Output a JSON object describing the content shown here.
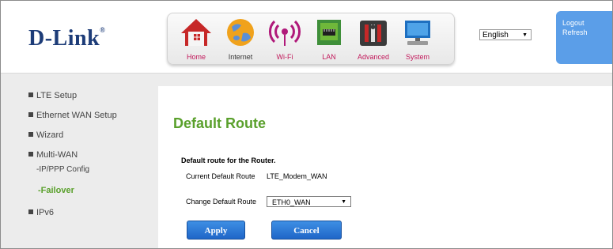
{
  "brand": {
    "logo": "D-Link"
  },
  "nav": [
    {
      "label": "Home",
      "icon": "home-icon",
      "active": false
    },
    {
      "label": "Internet",
      "icon": "globe-icon",
      "active": true
    },
    {
      "label": "Wi-Fi",
      "icon": "wifi-icon",
      "active": false
    },
    {
      "label": "LAN",
      "icon": "lan-icon",
      "active": false
    },
    {
      "label": "Advanced",
      "icon": "advanced-tools-icon",
      "active": false
    },
    {
      "label": "System",
      "icon": "system-computer-icon",
      "active": false
    }
  ],
  "language": {
    "selected": "English"
  },
  "account": {
    "logout": "Logout",
    "refresh": "Refresh"
  },
  "sidebar": {
    "items": [
      {
        "label": "LTE Setup"
      },
      {
        "label": "Ethernet WAN Setup"
      },
      {
        "label": "Wizard"
      },
      {
        "label": "Multi-WAN"
      },
      {
        "label": "-IP/PPP Config"
      },
      {
        "label": "-Failover"
      },
      {
        "label": "IPv6"
      }
    ]
  },
  "page": {
    "title": "Default Route",
    "subtitle": "Default route for the Router.",
    "current_label": "Current Default Route",
    "current_value": "LTE_Modem_WAN",
    "change_label": "Change Default Route",
    "change_value": "ETH0_WAN"
  },
  "buttons": {
    "apply": "Apply",
    "cancel": "Cancel"
  },
  "colors": {
    "accent_green": "#5aa02c",
    "button_blue": "#2a77d6",
    "corner_blue": "#5b9ee8",
    "nav_label": "#c2185b"
  }
}
